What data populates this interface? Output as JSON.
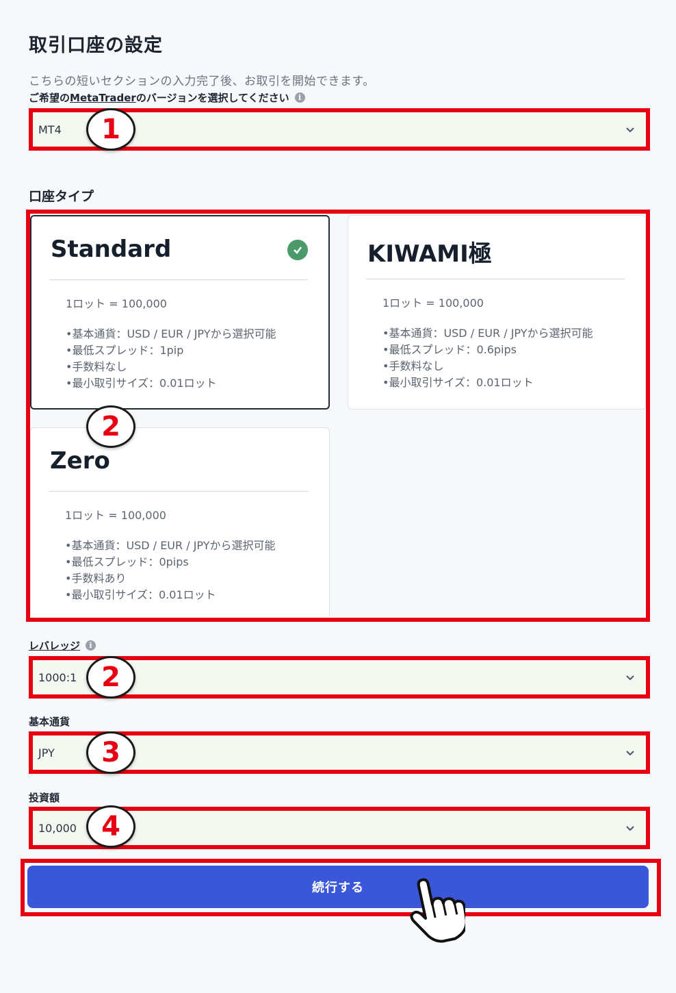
{
  "page": {
    "title": "取引口座の設定",
    "subtitle": "こちらの短いセクションの入力完了後、お取引を開始できます。"
  },
  "platform": {
    "label_prefix": "ご希望の",
    "label_link": "MetaTrader",
    "label_suffix": "のバージョンを選択してください",
    "value": "MT4",
    "badge": "1"
  },
  "account_types": {
    "title": "口座タイプ",
    "badge": "2",
    "cards": [
      {
        "name": "Standard",
        "lot": "1ロット = 100,000",
        "features": [
          "•基本通貨：USD / EUR / JPYから選択可能",
          "•最低スプレッド：1pip",
          "•手数料なし",
          "•最小取引サイズ：0.01ロット"
        ],
        "selected": true
      },
      {
        "name": "KIWAMI極",
        "lot": "1ロット = 100,000",
        "features": [
          "•基本通貨：USD / EUR / JPYから選択可能",
          "•最低スプレッド：0.6pips",
          "•手数料なし",
          "•最小取引サイズ：0.01ロット"
        ],
        "selected": false
      },
      {
        "name": "Zero",
        "lot": "1ロット = 100,000",
        "features": [
          "•基本通貨：USD / EUR / JPYから選択可能",
          "•最低スプレッド：0pips",
          "•手数料あり",
          "•最小取引サイズ：0.01ロット"
        ],
        "selected": false
      }
    ]
  },
  "leverage": {
    "label": "レバレッジ",
    "value": "1000:1",
    "badge": "2"
  },
  "base_currency": {
    "label": "基本通貨",
    "value": "JPY",
    "badge": "3"
  },
  "investment": {
    "label": "投資額",
    "value": "10,000",
    "badge": "4"
  },
  "continue_button": {
    "label": "続行する"
  },
  "icons": {
    "info": "info-icon",
    "chevron": "chevron-down-icon",
    "check": "check-circle-icon",
    "cursor": "hand-pointer-icon"
  },
  "colors": {
    "highlight": "#e60012",
    "primary": "#3b57d9",
    "check": "#4a9a6a",
    "select_bg": "#f3f8f0"
  }
}
